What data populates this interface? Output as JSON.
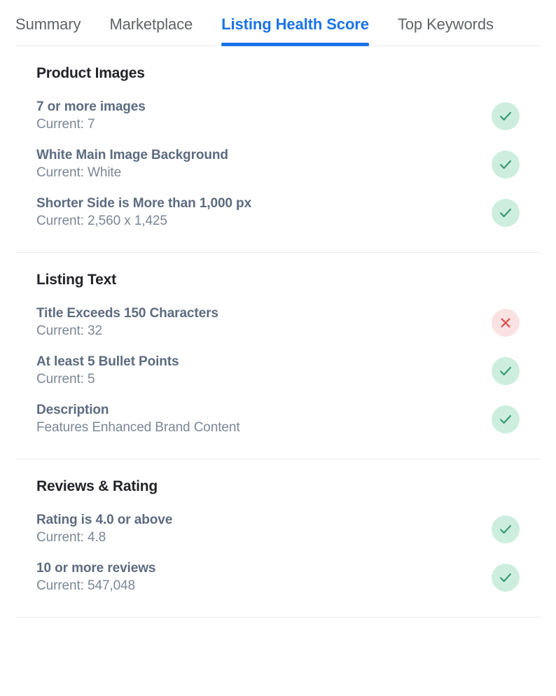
{
  "tabs": [
    {
      "label": "Summary",
      "active": false
    },
    {
      "label": "Marketplace",
      "active": false
    },
    {
      "label": "Listing Health Score",
      "active": true
    },
    {
      "label": "Top Keywords",
      "active": false
    }
  ],
  "colors": {
    "active_tab": "#1a73e8",
    "inactive_tab": "#5f6368",
    "section_title": "#222429",
    "row_title": "#5c6b80",
    "row_sub": "#7b8797",
    "pass_bg": "#cdeedf",
    "pass_fg": "#3a9b76",
    "fail_bg": "#fbe2e2",
    "fail_fg": "#e05252",
    "divider": "#e8eaed"
  },
  "sections": [
    {
      "title": "Product Images",
      "rows": [
        {
          "title": "7 or more images",
          "sub": "Current: 7",
          "status": "pass",
          "icon": "check-icon"
        },
        {
          "title": "White Main Image Background",
          "sub": "Current: White",
          "status": "pass",
          "icon": "check-icon"
        },
        {
          "title": "Shorter Side is More than 1,000 px",
          "sub": "Current: 2,560 x 1,425",
          "status": "pass",
          "icon": "check-icon"
        }
      ]
    },
    {
      "title": "Listing Text",
      "rows": [
        {
          "title": "Title Exceeds 150 Characters",
          "sub": "Current: 32",
          "status": "fail",
          "icon": "close-icon"
        },
        {
          "title": "At least 5 Bullet Points",
          "sub": "Current: 5",
          "status": "pass",
          "icon": "check-icon"
        },
        {
          "title": "Description",
          "sub": "Features Enhanced Brand Content",
          "status": "pass",
          "icon": "check-icon"
        }
      ]
    },
    {
      "title": "Reviews & Rating",
      "rows": [
        {
          "title": "Rating is 4.0 or above",
          "sub": "Current: 4.8",
          "status": "pass",
          "icon": "check-icon"
        },
        {
          "title": "10 or more reviews",
          "sub": "Current: 547,048",
          "status": "pass",
          "icon": "check-icon"
        }
      ]
    }
  ]
}
